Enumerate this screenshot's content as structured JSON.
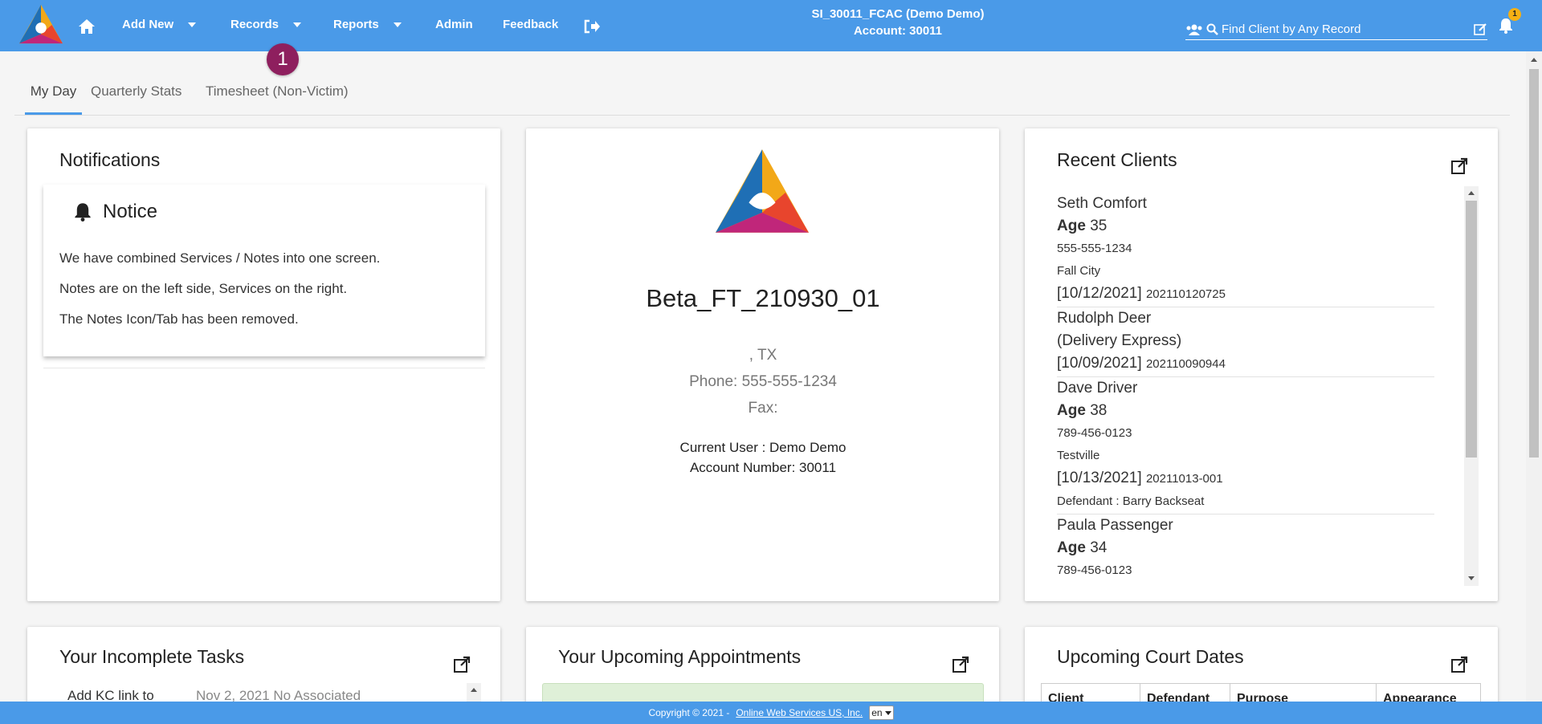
{
  "nav": {
    "items": [
      {
        "label": "Add New",
        "dropdown": true
      },
      {
        "label": "Records",
        "dropdown": true
      },
      {
        "label": "Reports",
        "dropdown": true
      },
      {
        "label": "Admin",
        "dropdown": false
      },
      {
        "label": "Feedback",
        "dropdown": false
      }
    ],
    "account_line1": "SI_30011_FCAC (Demo Demo)",
    "account_line2": "Account: 30011",
    "search_placeholder": "Find Client by Any Record",
    "notification_count": "1",
    "accent_color": "#4a9ae8"
  },
  "callout": {
    "number": "1"
  },
  "tabs": [
    {
      "label": "My Day",
      "active": true
    },
    {
      "label": "Quarterly Stats",
      "active": false
    },
    {
      "label": "Timesheet (Non-Victim)",
      "active": false
    }
  ],
  "notifications": {
    "title": "Notifications",
    "notice_title": "Notice",
    "lines": [
      "We have combined Services / Notes into one screen.",
      "Notes are on the left side, Services on the right.",
      "The Notes Icon/Tab has been removed."
    ]
  },
  "agency": {
    "name": "Beta_FT_210930_01",
    "location": ", TX",
    "phone": "Phone: 555-555-1234",
    "fax": "Fax:",
    "current_user": "Current User : Demo Demo",
    "account_number": "Account Number: 30011"
  },
  "recent_clients": {
    "title": "Recent Clients",
    "items": [
      {
        "name": "Seth Comfort",
        "age_label": "Age",
        "age": "35",
        "phone": "555-555-1234",
        "city": "Fall City",
        "date": "[10/12/2021]",
        "id": "202110120725",
        "extra": ""
      },
      {
        "name": "Rudolph Deer",
        "sub": "(Delivery Express)",
        "date": "[10/09/2021]",
        "id": "202110090944"
      },
      {
        "name": "Dave Driver",
        "age_label": "Age",
        "age": "38",
        "phone": "789-456-0123",
        "city": "Testville",
        "date": "[10/13/2021]",
        "id": "20211013-001",
        "extra": "Defendant : Barry Backseat"
      },
      {
        "name": "Paula Passenger",
        "age_label": "Age",
        "age": "34",
        "phone": "789-456-0123"
      }
    ]
  },
  "tasks": {
    "title": "Your Incomplete Tasks",
    "first_task": "Add KC link to",
    "first_date": "Nov 2, 2021  No Associated"
  },
  "appointments": {
    "title": "Your Upcoming Appointments"
  },
  "court": {
    "title": "Upcoming Court Dates",
    "columns": [
      "Client",
      "Defendant",
      "Purpose",
      "Appearance"
    ]
  },
  "footer": {
    "copyright": "Copyright © 2021 -",
    "link": "Online Web Services US, Inc.",
    "language": "en"
  }
}
